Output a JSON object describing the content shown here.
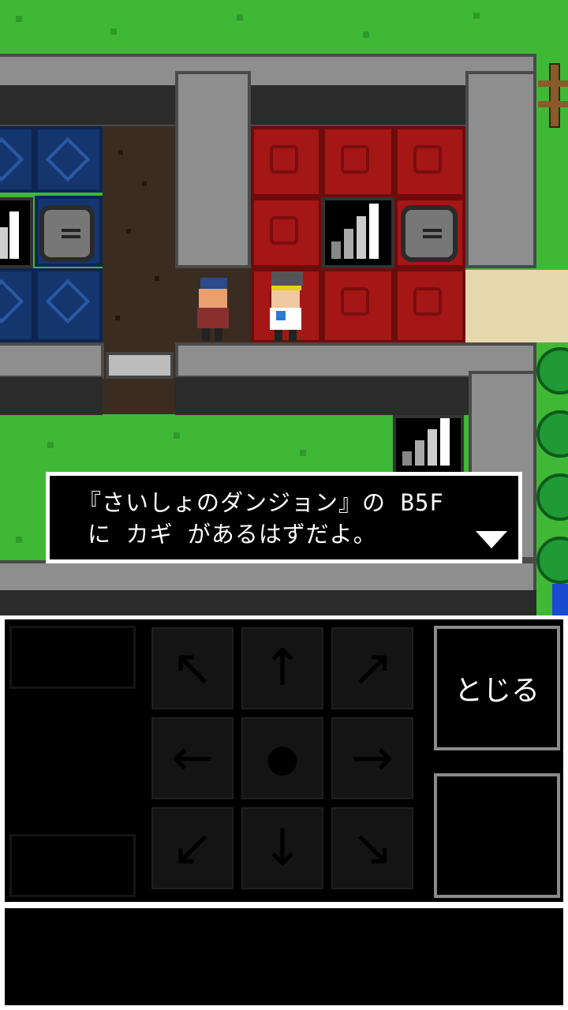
{
  "dialog": {
    "line1": "『さいしょのダンジョン』の B5F",
    "line2": "に カギ があるはずだよ。"
  },
  "controls": {
    "close_label": "とじる",
    "dpad": {
      "up_left": "↖",
      "up": "↑",
      "up_right": "↗",
      "left": "←",
      "center": "●",
      "right": "→",
      "down_left": "↙",
      "down": "↓",
      "down_right": "↘"
    }
  },
  "colors": {
    "grass": "#3fb836",
    "wall": "#8e8e8e",
    "blue_floor": "#15356e",
    "red_floor": "#a51616",
    "dialog_bg": "#000000",
    "dialog_border": "#ffffff"
  }
}
